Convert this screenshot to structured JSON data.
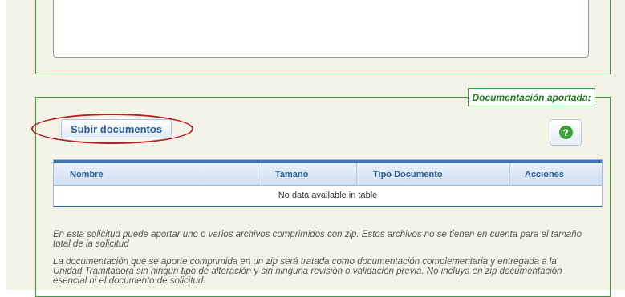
{
  "documentacion": {
    "legend": "Documentación aportada:",
    "upload_button": "Subir documentos",
    "help_icon": "question-circle-icon",
    "table": {
      "columns": [
        "Nombre",
        "Tamano",
        "Tipo Documento",
        "Acciones"
      ],
      "empty_message": "No data available in table"
    },
    "info_paragraphs": [
      "En esta solicitud puede aportar uno o varios archivos comprimidos con zip. Estos archivos no se tienen en cuenta para el tamaño total de la solicitud",
      "La documentación que se aporte comprimida en un zip será tratada como documentación complementaria y entregada a la Unidad Tramitadora sin ningún tipo de alteración y sin ninguna revisión o validación previa. No incluya en zip documentación esencial ni el documento de solicitud."
    ]
  },
  "colors": {
    "accent_green": "#3d9a3d",
    "header_blue": "#2b5d97",
    "highlight_red": "#b22222",
    "background": "#f4f3e7"
  }
}
